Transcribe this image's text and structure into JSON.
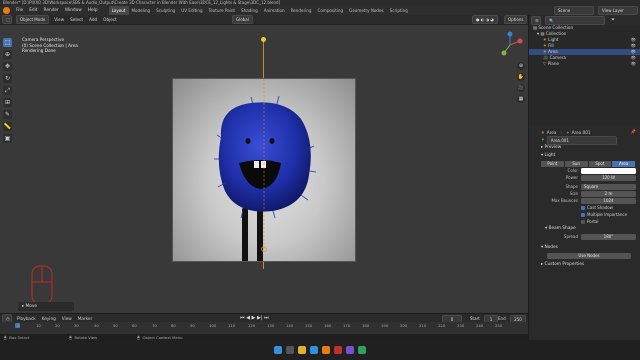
{
  "window": {
    "title": "Blender* [D:\\PIXXO 3D\\Workspace\\SBS & Audio_Output\\Create 3D Character in Blender With Ease\\3DCE_12_Lights & Stage\\3DC_12.blend]"
  },
  "menus": [
    "File",
    "Edit",
    "Render",
    "Window",
    "Help"
  ],
  "workspaces": [
    "Layout",
    "Modeling",
    "Sculpting",
    "UV Editing",
    "Texture Paint",
    "Shading",
    "Animation",
    "Rendering",
    "Compositing",
    "Geometry Nodes",
    "Scripting"
  ],
  "active_workspace": "Layout",
  "top_right": {
    "scene": "Scene",
    "view_layer": "View Layer"
  },
  "viewport_header": {
    "mode": "Object Mode",
    "items": [
      "View",
      "Select",
      "Add",
      "Object"
    ],
    "orientation": "Global",
    "options": "Options"
  },
  "viewport_overlay": {
    "line1": "Camera Perspective",
    "line2": "(0) Scene Collection | Area",
    "line3": "Rendering Done"
  },
  "move_panel": {
    "label": "Move"
  },
  "timeline_header": {
    "items": [
      "Playback",
      "Keying",
      "View",
      "Marker"
    ],
    "start_label": "Start",
    "start": "1",
    "end_label": "End",
    "end": "250",
    "current": "0"
  },
  "timeline_ticks": [
    "0",
    "10",
    "20",
    "30",
    "40",
    "50",
    "60",
    "70",
    "80",
    "90",
    "100",
    "110",
    "120",
    "130",
    "140",
    "150",
    "160",
    "170",
    "180",
    "190",
    "200",
    "210",
    "220",
    "230",
    "240",
    "250"
  ],
  "statusbar": {
    "left": "Box Select",
    "mid1": "Rotate View",
    "mid2": "Object Context Menu",
    "version": "3.6.0"
  },
  "outliner": {
    "root": "Scene Collection",
    "items": [
      {
        "label": "Collection",
        "depth": 1
      },
      {
        "label": "Light",
        "depth": 2
      },
      {
        "label": "Fill",
        "depth": 2
      },
      {
        "label": "Area",
        "depth": 2,
        "selected": true
      },
      {
        "label": "Camera",
        "depth": 2
      },
      {
        "label": "Plane",
        "depth": 2
      }
    ]
  },
  "properties": {
    "object_name": "Area",
    "data_name": "Area.001",
    "data_field": "Area.001",
    "section_preview": "Preview",
    "section_light": "Light",
    "light_types": [
      "Point",
      "Sun",
      "Spot",
      "Area"
    ],
    "active_light_type": "Area",
    "color_label": "Color",
    "power_label": "Power",
    "power": "120 W",
    "shape_label": "Shape",
    "shape": "Square",
    "size_label": "Size",
    "size": "2 m",
    "max_bounces_label": "Max Bounces",
    "max_bounces": "1024",
    "cast_shadow": "Cast Shadow",
    "multiple_importance": "Multiple Importance",
    "portal": "Portal",
    "section_beam": "Beam Shape",
    "spread_label": "Spread",
    "spread": "180°",
    "section_nodes": "Nodes",
    "use_nodes": "Use Nodes",
    "section_custom": "Custom Properties"
  },
  "colors": {
    "accent": "#4772b3",
    "character": "#1f2fa8",
    "light_color": "#ffffff"
  }
}
